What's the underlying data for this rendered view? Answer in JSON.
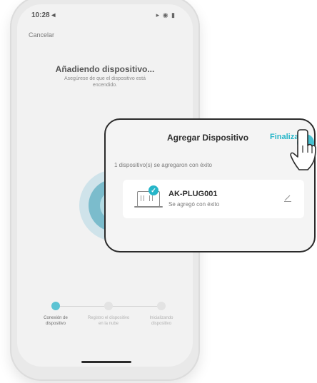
{
  "status": {
    "time": "10:28 ◂",
    "indicators": "▸ ◉ ▮"
  },
  "nav": {
    "cancel_label": "Cancelar"
  },
  "screen": {
    "title": "Añadiendo dispositivo...",
    "subtitle": "Asegúrese de que el dispositivo está encendido."
  },
  "steps": [
    {
      "label": "Conexión de dispositivo"
    },
    {
      "label": "Registro el dispositivo en la nube"
    },
    {
      "label": "Inicializando dispositivo"
    }
  ],
  "dialog": {
    "title": "Agregar Dispositivo",
    "done_label": "Finalizado",
    "note": "1 dispositivo(s) se agregaron con éxito",
    "device": {
      "name": "AK-PLUG001",
      "status": "Se agregó con éxito"
    }
  },
  "colors": {
    "accent": "#27b6c9",
    "step_active": "#5cc3d3"
  },
  "icons": {
    "check": "check-icon",
    "edit": "edit-icon",
    "device": "plug-device-icon",
    "tap": "tap-hand-icon"
  }
}
